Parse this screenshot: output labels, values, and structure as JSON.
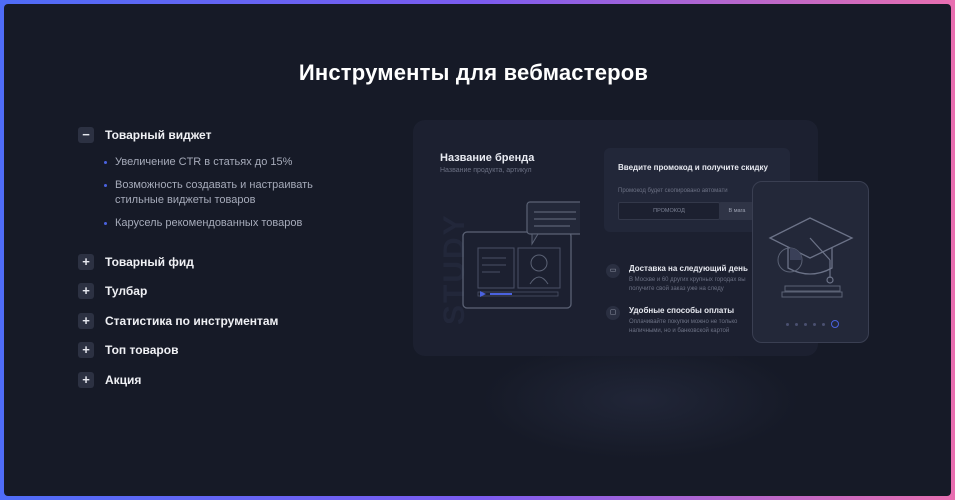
{
  "page_title": "Инструменты для вебмастеров",
  "accordion": {
    "items": [
      {
        "label": "Товарный виджет",
        "toggle": "−",
        "expanded": true,
        "bullets": [
          "Увеличение CTR в статьях до 15%",
          "Возможность создавать и настраивать стильные виджеты товаров",
          "Карусель рекомендованных товаров"
        ]
      },
      {
        "label": "Товарный фид",
        "toggle": "+"
      },
      {
        "label": "Тулбар",
        "toggle": "+"
      },
      {
        "label": "Статистика по инструментам",
        "toggle": "+"
      },
      {
        "label": "Топ товаров",
        "toggle": "+"
      },
      {
        "label": "Акция",
        "toggle": "+"
      }
    ]
  },
  "preview": {
    "brand_title": "Название бренда",
    "brand_subtitle": "Название продукта, артикул",
    "study_text": "STUDY",
    "promo": {
      "title": "Введите промокод и получите скидку",
      "hint": "Промокод будет скопировано автомати",
      "input_placeholder": "ПРОМОКОД",
      "apply_label": "В мага"
    },
    "features": [
      {
        "title": "Доставка на следующий день",
        "desc": "В Москве и 60 других крупных городах вы получите свой заказ уже на следу",
        "icon": "truck-icon"
      },
      {
        "title": "Удобные способы оплаты",
        "desc": "Оплачивайте покупки можно не только наличными, но и банковской картой",
        "icon": "card-icon"
      }
    ]
  },
  "colors": {
    "accent": "#4a62e0",
    "background": "#161a27",
    "card": "#1c2030"
  }
}
